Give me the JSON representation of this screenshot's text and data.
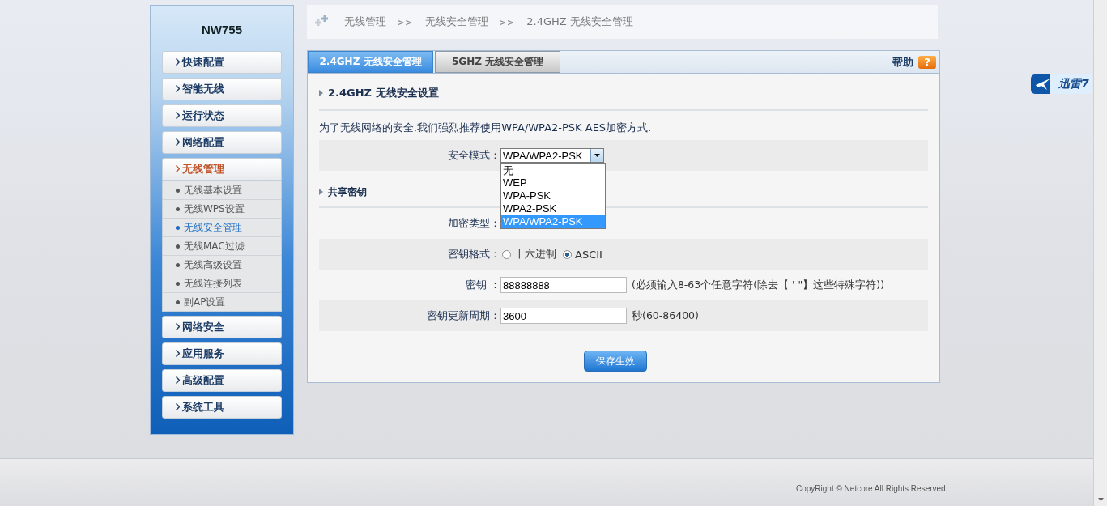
{
  "sidebar": {
    "title": "NW755",
    "menu": [
      {
        "label": "快速配置",
        "expanded": false
      },
      {
        "label": "智能无线",
        "expanded": false
      },
      {
        "label": "运行状态",
        "expanded": false
      },
      {
        "label": "网络配置",
        "expanded": false
      },
      {
        "label": "无线管理",
        "expanded": true,
        "children": [
          {
            "label": "无线基本设置",
            "selected": false
          },
          {
            "label": "无线WPS设置",
            "selected": false
          },
          {
            "label": "无线安全管理",
            "selected": true
          },
          {
            "label": "无线MAC过滤",
            "selected": false
          },
          {
            "label": "无线高级设置",
            "selected": false
          },
          {
            "label": "无线连接列表",
            "selected": false
          },
          {
            "label": "副AP设置",
            "selected": false
          }
        ]
      },
      {
        "label": "网络安全",
        "expanded": false
      },
      {
        "label": "应用服务",
        "expanded": false
      },
      {
        "label": "高级配置",
        "expanded": false
      },
      {
        "label": "系统工具",
        "expanded": false
      }
    ]
  },
  "breadcrumb": [
    {
      "kind": "crumb",
      "text": "无线管理"
    },
    {
      "kind": "separator",
      "text": ">>"
    },
    {
      "kind": "crumb",
      "text": "无线安全管理"
    },
    {
      "kind": "separator",
      "text": ">>"
    },
    {
      "kind": "crumb",
      "text": "2.4GHZ 无线安全管理"
    }
  ],
  "tabs": [
    {
      "label": "2.4GHZ 无线安全管理",
      "selected": true
    },
    {
      "label": "5GHZ 无线安全管理",
      "selected": false
    }
  ],
  "help": {
    "label": "帮助",
    "icon": "?"
  },
  "section_1": {
    "title": "2.4GHZ 无线安全设置",
    "note": "为了无线网络的安全,我们强烈推荐使用WPA/WPA2-PSK AES加密方式.",
    "security_mode": {
      "label": "安全模式：",
      "value": "WPA/WPA2-PSK",
      "expanded": true,
      "options": [
        {
          "label": "无",
          "selected": false
        },
        {
          "label": "WEP",
          "selected": false
        },
        {
          "label": "WPA-PSK",
          "selected": false
        },
        {
          "label": "WPA2-PSK",
          "selected": false
        },
        {
          "label": "WPA/WPA2-PSK",
          "selected": true
        }
      ]
    }
  },
  "section_2": {
    "title": "共享密钥",
    "rows": [
      {
        "kind": "label",
        "label": "加密类型："
      },
      {
        "kind": "radio",
        "label": "密钥格式：",
        "options": [
          {
            "label": "十六进制",
            "selected": false
          },
          {
            "label": "ASCII",
            "selected": true
          }
        ]
      },
      {
        "kind": "input",
        "label": "密钥 ：",
        "value": "88888888",
        "hint": "(必须输入8-63个任意字符(除去【 ' \"】这些特殊字符))"
      },
      {
        "kind": "input",
        "label": "密钥更新周期：",
        "value": "3600",
        "hint": "秒(60-86400)"
      }
    ]
  },
  "save_button": "保存生效",
  "footer": {
    "copyright": "CopyRight © Netcore All Rights Reserved."
  },
  "floating_badge": {
    "label": "迅雷7"
  }
}
